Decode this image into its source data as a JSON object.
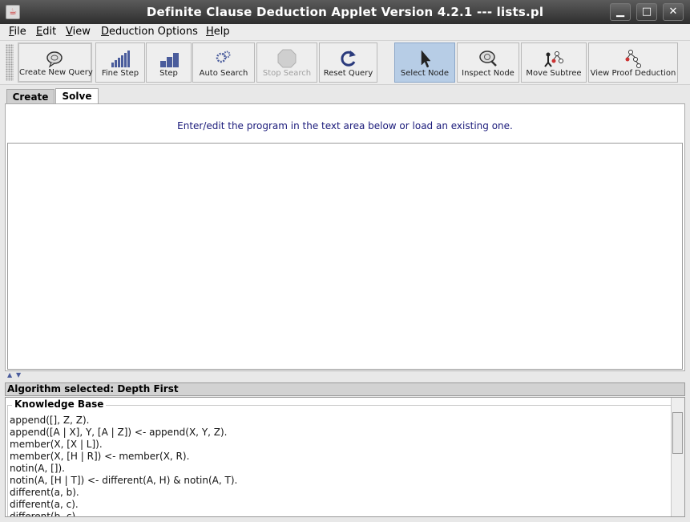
{
  "window": {
    "title": "Definite Clause Deduction Applet Version 4.2.1 --- lists.pl"
  },
  "menu": {
    "items": [
      "File",
      "Edit",
      "View",
      "Deduction Options",
      "Help"
    ]
  },
  "toolbar": {
    "create_new_query": "Create New Query",
    "fine_step": "Fine Step",
    "step": "Step",
    "auto_search": "Auto Search",
    "stop_search": "Stop Search",
    "reset_query": "Reset Query",
    "select_node": "Select Node",
    "inspect_node": "Inspect Node",
    "move_subtree": "Move Subtree",
    "view_proof_deduction": "View Proof Deduction"
  },
  "tabs": {
    "create": "Create",
    "solve": "Solve",
    "selected": "Solve"
  },
  "main": {
    "info": "Enter/edit the program in the text area below or load an existing one.",
    "editor_text": ""
  },
  "status": {
    "text": "Algorithm selected: Depth First"
  },
  "knowledge_base": {
    "title": "Knowledge Base",
    "lines": [
      "append([], Z, Z).",
      "append([A | X], Y, [A | Z]) <- append(X, Y, Z).",
      "member(X, [X | L]).",
      "member(X, [H | R]) <- member(X, R).",
      "notin(A, []).",
      "notin(A, [H | T]) <- different(A, H) & notin(A, T).",
      "different(a, b).",
      "different(a, c).",
      "different(b, c)."
    ]
  },
  "colors": {
    "titlebar": "#3f3f3f",
    "active_button": "#b7cde6",
    "info_text": "#1a1a7a"
  }
}
